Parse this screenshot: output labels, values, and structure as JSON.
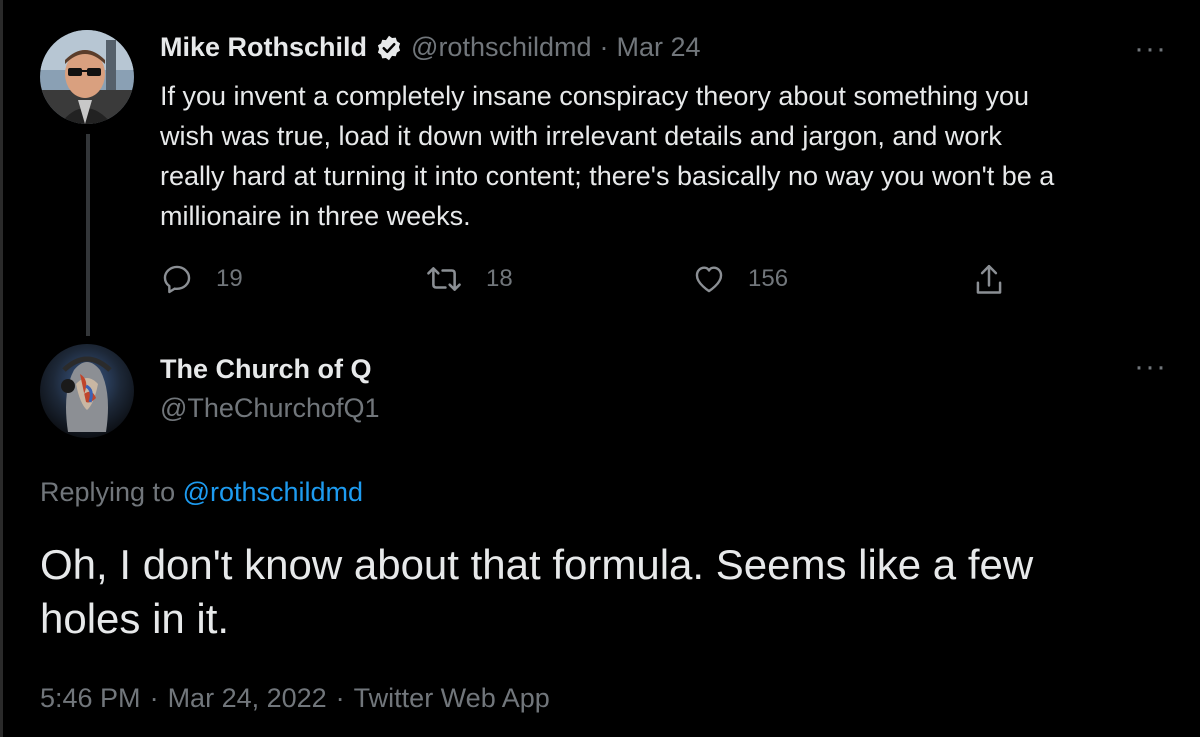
{
  "parent_tweet": {
    "author_name": "Mike Rothschild",
    "verified": true,
    "handle": "@rothschildmd",
    "separator": "·",
    "date": "Mar 24",
    "text": "If you invent a completely insane conspiracy theory about something you wish was true, load it down with irrelevant details and jargon, and work really hard at turning it into content; there's basically no way you won't be a millionaire in three weeks.",
    "text_lines": [
      "If you invent a completely insane conspiracy theory about something you",
      "wish was true, load it down with irrelevant details and jargon, and work",
      "really hard at turning it into content; there's basically no way you won't be a",
      "millionaire in three weeks."
    ],
    "actions": {
      "reply_count": "19",
      "retweet_count": "18",
      "like_count": "156"
    },
    "more_label": "···"
  },
  "reply_tweet": {
    "author_name": "The Church of Q",
    "handle": "@TheChurchofQ1",
    "replying_prefix": "Replying to ",
    "replying_to": "@rothschildmd",
    "text_lines": [
      "Oh, I don't know about that formula. Seems like a few",
      "holes in it."
    ],
    "time": "5:46 PM",
    "separator": "·",
    "date": "Mar 24, 2022",
    "source": "Twitter Web App",
    "more_label": "···"
  },
  "icons": [
    "reply-icon",
    "retweet-icon",
    "like-icon",
    "share-icon",
    "verified-badge-icon",
    "more-icon"
  ],
  "colors": {
    "background": "#000000",
    "text": "#e7e9ea",
    "muted": "#71767b",
    "link": "#1d9bf0",
    "verified": "#e7e9ea"
  }
}
